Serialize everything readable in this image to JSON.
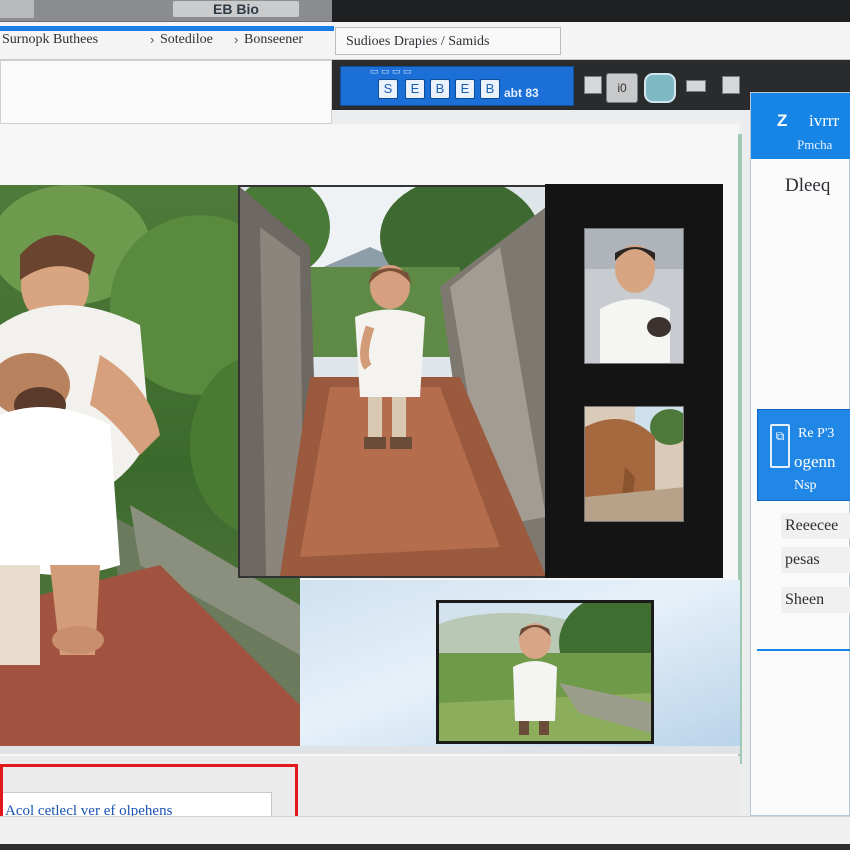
{
  "window": {
    "title": "EB Bio"
  },
  "breadcrumbs": {
    "items": [
      "Surnopk Buthees",
      "Sotediloe",
      "Bonseener"
    ],
    "separator": "›",
    "active": "Sudioes Drapies / Samids"
  },
  "toolbar": {
    "group_label": "▭ ▭ ▭ ▭",
    "buttons": [
      "S",
      "E",
      "B",
      "E",
      "B"
    ],
    "zoom_label": "abt 83",
    "box_label": "i0"
  },
  "properties": {
    "header_number": "Z",
    "header_title": "ivrrr",
    "header_sub": "Pmcha",
    "first_item": "Dleeq",
    "section": {
      "icon": "⧉",
      "line1": "Re P'3",
      "line2": "ogenn",
      "line3": "Nsp"
    },
    "rows": [
      "Reeecee",
      "pesas",
      "Sheen"
    ]
  },
  "status": {
    "text": "Acol cetlecl ver ef olpehens"
  },
  "colors": {
    "accent": "#1785e5",
    "progress": "#1a7ee6",
    "alert_border": "#e3181c",
    "status_text": "#1c55b4"
  }
}
